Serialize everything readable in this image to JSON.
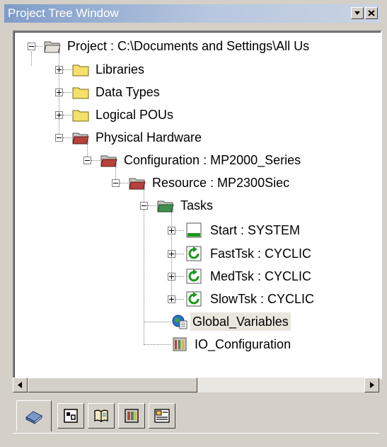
{
  "window": {
    "title": "Project Tree Window"
  },
  "tree": {
    "project": "Project : C:\\Documents and Settings\\All Us",
    "libraries": "Libraries",
    "data_types": "Data Types",
    "logical_pous": "Logical POUs",
    "physical_hardware": "Physical Hardware",
    "configuration": "Configuration : MP2000_Series",
    "resource": "Resource : MP2300Siec",
    "tasks": "Tasks",
    "task_start": "Start : SYSTEM",
    "task_fast": "FastTsk : CYCLIC",
    "task_med": "MedTsk : CYCLIC",
    "task_slow": "SlowTsk : CYCLIC",
    "global_variables": "Global_Variables",
    "io_configuration": "IO_Configuration"
  },
  "icons": {
    "folder": "folder-icon",
    "folder_open": "folder-open-icon",
    "hardware_folder": "hardware-folder-icon",
    "task_system": "system-task-icon",
    "task_cyclic": "cyclic-task-icon",
    "globe": "global-variables-icon",
    "io": "io-configuration-icon"
  },
  "tabs": [
    "project-tab-icon",
    "pou-tab-icon",
    "library-tab-icon",
    "hardware-tab-icon",
    "variables-tab-icon"
  ],
  "colors": {
    "titlebar_start": "#7f9cc8",
    "titlebar_end": "#c9d3e3",
    "folder_yellow": "#f4e06a",
    "hardware_red": "#b8413d",
    "cyclic_green": "#1a9a1a",
    "selection_bg": "#e9e6de"
  }
}
